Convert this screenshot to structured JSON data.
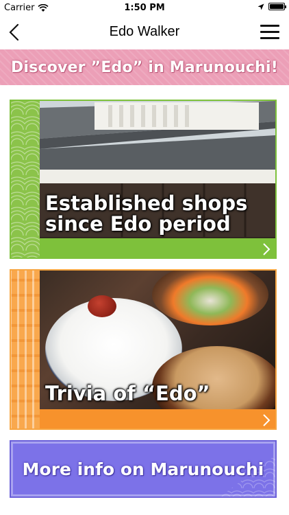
{
  "status_bar": {
    "carrier": "Carrier",
    "time": "1:50 PM",
    "wifi_icon": "wifi-icon",
    "location_icon": "location-arrow-icon",
    "battery_level": 1.0
  },
  "nav": {
    "title": "Edo Walker",
    "back_icon": "chevron-left-icon",
    "menu_icon": "hamburger-menu-icon"
  },
  "banner": {
    "text": "Discover ”Edo” in Marunouchi!",
    "color": "#ec9fb7"
  },
  "cards": [
    {
      "label_line1": "Established shops",
      "label_line2": "since Edo period",
      "accent": "#7ec13b",
      "chevron_icon": "chevron-right-icon"
    },
    {
      "label_line1": "Trivia of “Edo”",
      "accent": "#f7922c",
      "chevron_icon": "chevron-right-icon"
    }
  ],
  "info_button": {
    "label": "More info on Marunouchi",
    "color": "#7c72e8"
  }
}
